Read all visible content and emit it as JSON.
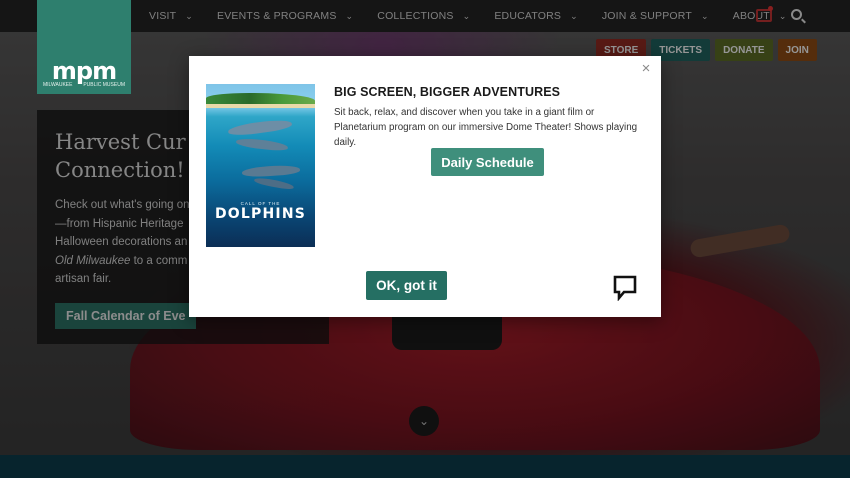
{
  "nav": {
    "logo_text": "mpm",
    "logo_sub_left": "MILWAUKEE",
    "logo_sub_right": "PUBLIC MUSEUM",
    "items": [
      {
        "label": "VISIT"
      },
      {
        "label": "EVENTS & PROGRAMS"
      },
      {
        "label": "COLLECTIONS"
      },
      {
        "label": "EDUCATORS"
      },
      {
        "label": "JOIN & SUPPORT"
      },
      {
        "label": "ABOUT"
      }
    ],
    "icons": [
      "chat-icon",
      "search-icon"
    ]
  },
  "utility_buttons": [
    {
      "label": "STORE",
      "color": "#8e2a22"
    },
    {
      "label": "TICKETS",
      "color": "#1f5f5c"
    },
    {
      "label": "DONATE",
      "color": "#5a6a24"
    },
    {
      "label": "JOIN",
      "color": "#8a4a14"
    }
  ],
  "hero": {
    "title_line1": "Harvest Cur",
    "title_line2": "Connection!",
    "text_part1": "Check out what's going on",
    "text_part2": "—from Hispanic Heritage",
    "text_part3": "Halloween decorations an",
    "text_italic": "Old Milwaukee",
    "text_part4": " to a comm",
    "text_part5": "artisan fair.",
    "cta_label": "Fall Calendar of Eve"
  },
  "modal": {
    "close_label": "×",
    "poster_subtitle": "CALL OF THE",
    "poster_title": "DOLPHINS",
    "heading": "BIG SCREEN, BIGGER ADVENTURES",
    "body": "Sit back, relax, and discover when you take in a giant film or Planetarium program on our immersive Dome Theater! Shows playing daily.",
    "schedule_button": "Daily Schedule",
    "ok_button": "OK, got it"
  },
  "colors": {
    "brand_green": "#2e7f6e",
    "modal_button": "#3f8f7c",
    "ok_button": "#256f63"
  }
}
